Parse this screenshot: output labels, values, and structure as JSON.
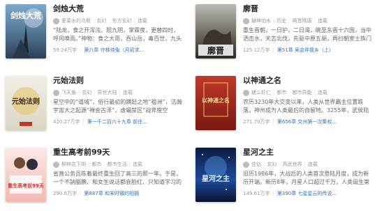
{
  "books": [
    {
      "title": "剑烛大荒",
      "author": "爱荽水的乌斯",
      "tags": [
        "玄幻",
        "东方玄幻"
      ],
      "status": "连载",
      "desc": "“陆龙，食之开浑沌、照九阴，掌霖夜，更替四时，呼风唤雨。”神物：食之大雨，吞山岳，毒百世，九头",
      "count": "59.24万字",
      "chapter": "第六章 守株待兔（月初求...",
      "cover_title": "剑烛大荒"
    },
    {
      "title": "廓晋",
      "author": "樋坤怕水",
      "tags": [
        "历史",
        "两晋隋唐"
      ],
      "status": "连载",
      "desc": "重生晋朝，一日护，二日渴，眺至东晋十六国，当中洒击水，天志北伐，先驱中原五胡，再扫朝室士族门阀，所",
      "count": "125.12万字",
      "chapter": "第51章 吴会非我乡（上）",
      "cover_title": "廓晋"
    },
    {
      "title": "元始法则",
      "author": "飞天鱼",
      "tags": [
        "玄幻",
        "异世大陆"
      ],
      "status": "连载",
      "desc": "星空中的“道域”，俗行最初的蹒跹之地“祖洲”，洁瀚宇宙大之起源“禅会古泽”，虚蝠禁区“战斧座空",
      "count": "420.27万字",
      "chapter": "第一千二百六十九章 前往...",
      "cover_title": "元始法则"
    },
    {
      "title": "以神通之名",
      "author": "猪么虾仁",
      "tags": [
        "都市",
        "都市异能"
      ],
      "status": "连载",
      "desc": "农历3230年大交变以来，人类从世界霸主位置跌落，神州成为人类最后的自留地。3255年，武侯陆祖在接受",
      "count": "271.79万字",
      "chapter": "第656章 交州第一次集权...",
      "cover_title": "以神通之名"
    },
    {
      "title": "重生高考前99天",
      "author": "柳林花下阴",
      "tags": [
        "都市",
        "都市生活"
      ],
      "status": "连载",
      "desc": "省直公务员陈着最终重生回了高三的那一年。于是，一个不訥腼腆、和女生说话都会脸红、只知道学习的高中",
      "count": "290.6万字",
      "chapter": "第887章 和宋时微的相拥",
      "cover_title": "重生高考前99天"
    },
    {
      "title": "星河之主",
      "author": "佳钻",
      "tags": [
        "玄幻",
        "高武世界"
      ],
      "status": "连载",
      "desc": "旧历1986年，大战后的人类首次登陆月度，成为新历开端。新历8年，月星人口超过千万，人类诞生第一位星空",
      "count": "149.61万字",
      "chapter": "第390章 七星星云的传说...",
      "cover_title": "星河之主"
    }
  ],
  "colors": {
    "link": "#3a6fb0",
    "muted": "#999999",
    "text": "#222222"
  }
}
